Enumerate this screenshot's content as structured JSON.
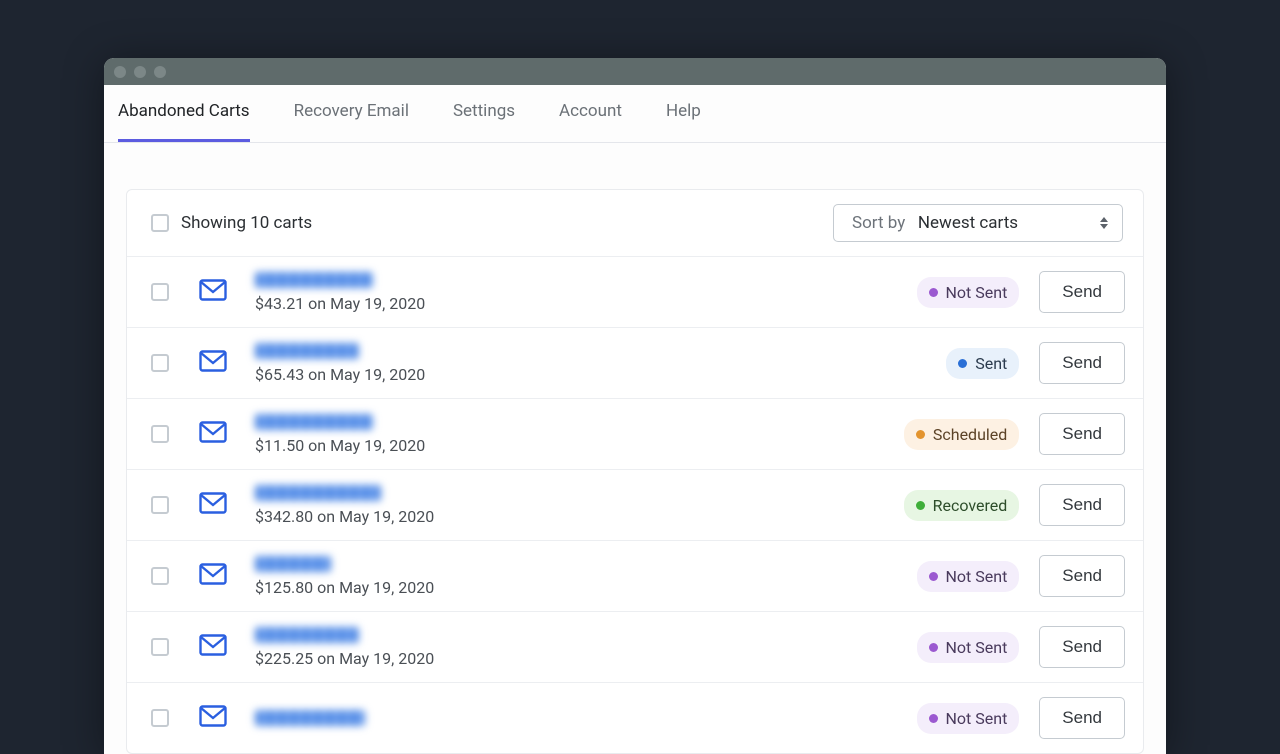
{
  "tabs": [
    "Abandoned Carts",
    "Recovery Email",
    "Settings",
    "Account",
    "Help"
  ],
  "active_tab": 0,
  "header": {
    "showing": "Showing 10 carts",
    "sort_label": "Sort by",
    "sort_value": "Newest carts"
  },
  "send_label": "Send",
  "status_labels": {
    "notsent": "Not Sent",
    "sent": "Sent",
    "scheduled": "Scheduled",
    "recovered": "Recovered"
  },
  "rows": [
    {
      "name_w": 118,
      "amount": "$43.21 on May 19, 2020",
      "status": "notsent"
    },
    {
      "name_w": 104,
      "amount": "$65.43 on May 19, 2020",
      "status": "sent"
    },
    {
      "name_w": 118,
      "amount": "$11.50 on May 19, 2020",
      "status": "scheduled"
    },
    {
      "name_w": 126,
      "amount": "$342.80 on May 19, 2020",
      "status": "recovered"
    },
    {
      "name_w": 76,
      "amount": "$125.80 on May 19, 2020",
      "status": "notsent"
    },
    {
      "name_w": 104,
      "amount": "$225.25 on May 19, 2020",
      "status": "notsent"
    },
    {
      "name_w": 110,
      "amount": "",
      "status": "notsent"
    }
  ]
}
